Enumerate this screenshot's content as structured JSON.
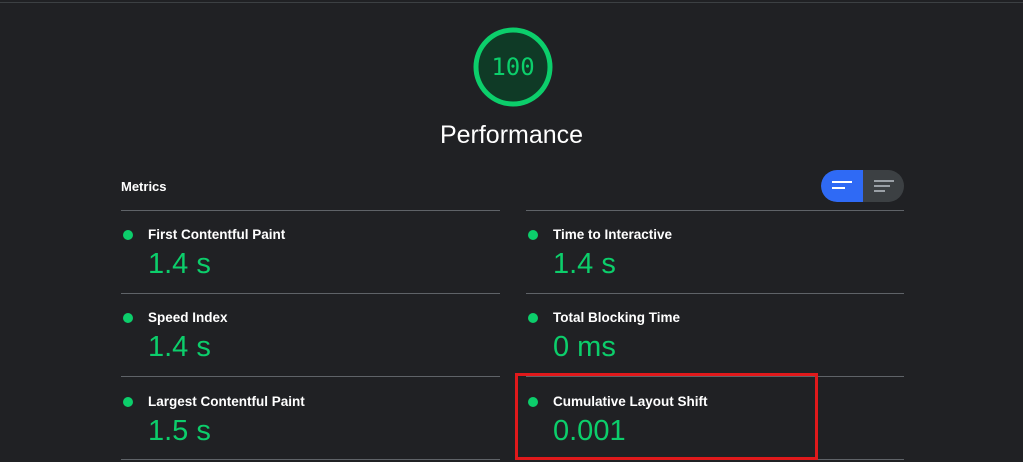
{
  "score": {
    "value": "100",
    "fraction": 1.0,
    "color": "#0cce6b"
  },
  "category_title": "Performance",
  "metrics_section": {
    "label": "Metrics",
    "view_toggle": {
      "active": "expanded",
      "active_color": "#2f6af5"
    }
  },
  "metrics": [
    {
      "name": "First Contentful Paint",
      "value": "1.4 s",
      "status": "pass"
    },
    {
      "name": "Time to Interactive",
      "value": "1.4 s",
      "status": "pass"
    },
    {
      "name": "Speed Index",
      "value": "1.4 s",
      "status": "pass"
    },
    {
      "name": "Total Blocking Time",
      "value": "0 ms",
      "status": "pass"
    },
    {
      "name": "Largest Contentful Paint",
      "value": "1.5 s",
      "status": "pass"
    },
    {
      "name": "Cumulative Layout Shift",
      "value": "0.001",
      "status": "pass"
    }
  ],
  "highlighted_metric": "Cumulative Layout Shift",
  "colors": {
    "pass": "#0cce6b",
    "highlight": "#e0191b",
    "background": "#202124"
  }
}
